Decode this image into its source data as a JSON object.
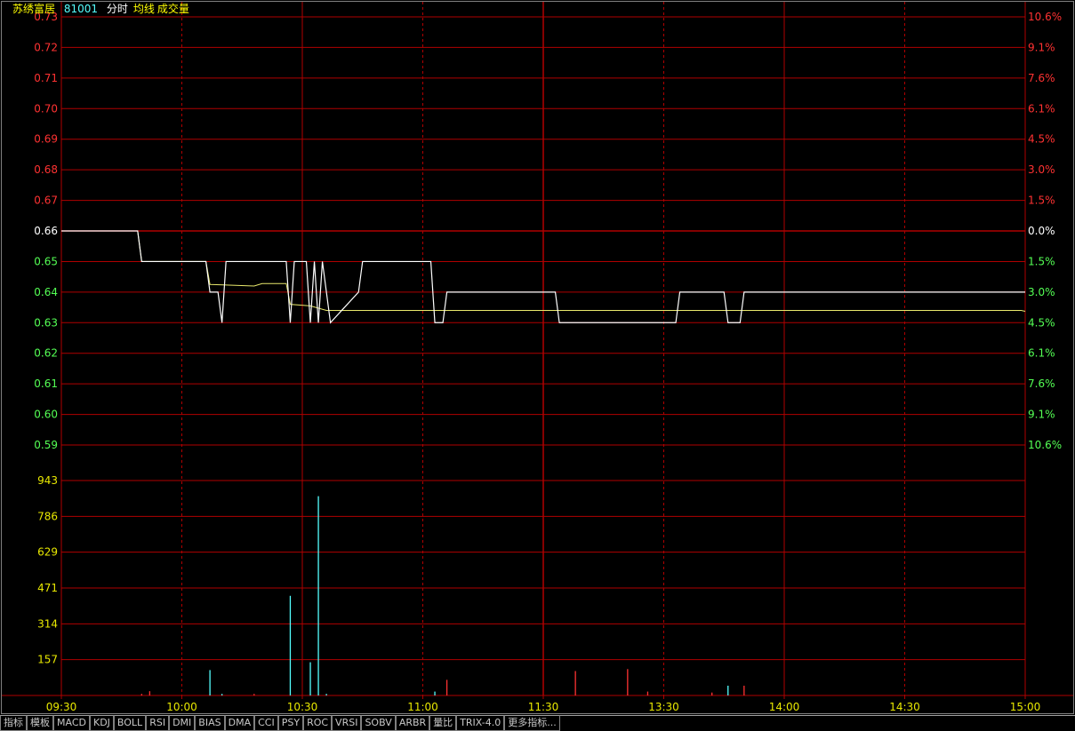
{
  "header": {
    "name": "苏绣富居",
    "code": "81001",
    "labels": [
      "分时",
      "均线",
      "成交量"
    ]
  },
  "colors": {
    "grid": "#b00000",
    "up": "#ff3232",
    "down": "#54ff54",
    "neutral": "#ffffff",
    "volume": "#e8e800",
    "price_line": "#ffffff",
    "avg_line": "#e8e86c",
    "vol_up": "#ff3232",
    "vol_down": "#54ffff"
  },
  "tabs": [
    "指标",
    "模板",
    "MACD",
    "KDJ",
    "BOLL",
    "RSI",
    "DMI",
    "BIAS",
    "DMA",
    "CCI",
    "PSY",
    "ROC",
    "VRSI",
    "SOBV",
    "ARBR",
    "量比",
    "TRIX-4.0",
    "更多指标..."
  ],
  "chart_data": {
    "type": "line",
    "prev_close": 0.66,
    "price_ticks": [
      "0.73",
      "0.72",
      "0.71",
      "0.70",
      "0.69",
      "0.68",
      "0.67",
      "0.66",
      "0.65",
      "0.64",
      "0.63",
      "0.62",
      "0.61",
      "0.60",
      "0.59"
    ],
    "pct_ticks": [
      "10.6%",
      "9.1%",
      "7.6%",
      "6.1%",
      "4.5%",
      "3.0%",
      "1.5%",
      "0.0%",
      "1.5%",
      "3.0%",
      "4.5%",
      "6.1%",
      "7.6%",
      "9.1%",
      "10.6%"
    ],
    "ylim": [
      0.59,
      0.73
    ],
    "volume_ticks": [
      "943",
      "786",
      "629",
      "471",
      "314",
      "157"
    ],
    "volume_max": 1100,
    "time_labels": [
      "09:30",
      "10:00",
      "10:30",
      "11:00",
      "11:30",
      "13:30",
      "14:00",
      "14:30",
      "15:00"
    ],
    "minutes_total": 240,
    "price": [
      [
        0,
        0.66
      ],
      [
        19,
        0.66
      ],
      [
        20,
        0.65
      ],
      [
        36,
        0.65
      ],
      [
        37,
        0.64
      ],
      [
        39,
        0.64
      ],
      [
        40,
        0.63
      ],
      [
        41,
        0.65
      ],
      [
        56,
        0.65
      ],
      [
        57,
        0.63
      ],
      [
        58,
        0.65
      ],
      [
        61,
        0.65
      ],
      [
        62,
        0.63
      ],
      [
        63,
        0.65
      ],
      [
        64,
        0.63
      ],
      [
        65,
        0.65
      ],
      [
        66,
        0.64
      ],
      [
        67,
        0.63
      ],
      [
        74,
        0.64
      ],
      [
        75,
        0.65
      ],
      [
        92,
        0.65
      ],
      [
        93,
        0.63
      ],
      [
        95,
        0.63
      ],
      [
        96,
        0.64
      ],
      [
        123,
        0.64
      ],
      [
        124,
        0.63
      ],
      [
        153,
        0.63
      ],
      [
        154,
        0.64
      ],
      [
        165,
        0.64
      ],
      [
        166,
        0.63
      ],
      [
        169,
        0.63
      ],
      [
        170,
        0.64
      ],
      [
        240,
        0.64
      ]
    ],
    "avg": [
      [
        0,
        0.66
      ],
      [
        19,
        0.66
      ],
      [
        20,
        0.65
      ],
      [
        36,
        0.65
      ],
      [
        37,
        0.6425
      ],
      [
        48,
        0.642
      ],
      [
        50,
        0.6428
      ],
      [
        56,
        0.6428
      ],
      [
        57,
        0.636
      ],
      [
        62,
        0.6355
      ],
      [
        66,
        0.634
      ],
      [
        75,
        0.634
      ],
      [
        120,
        0.634
      ],
      [
        239,
        0.634
      ],
      [
        240,
        0.6337
      ]
    ],
    "volume": [
      {
        "t": 20,
        "v": 8,
        "up": true
      },
      {
        "t": 22,
        "v": 22,
        "up": true
      },
      {
        "t": 37,
        "v": 130,
        "up": false
      },
      {
        "t": 40,
        "v": 8,
        "up": false
      },
      {
        "t": 48,
        "v": 8,
        "up": true
      },
      {
        "t": 57,
        "v": 510,
        "up": false
      },
      {
        "t": 62,
        "v": 170,
        "up": false
      },
      {
        "t": 64,
        "v": 1020,
        "up": false
      },
      {
        "t": 66,
        "v": 8,
        "up": false
      },
      {
        "t": 93,
        "v": 20,
        "up": false
      },
      {
        "t": 96,
        "v": 80,
        "up": true
      },
      {
        "t": 128,
        "v": 125,
        "up": true
      },
      {
        "t": 141,
        "v": 135,
        "up": true
      },
      {
        "t": 146,
        "v": 20,
        "up": true
      },
      {
        "t": 162,
        "v": 15,
        "up": true
      },
      {
        "t": 166,
        "v": 50,
        "up": false
      },
      {
        "t": 170,
        "v": 50,
        "up": true
      }
    ]
  }
}
